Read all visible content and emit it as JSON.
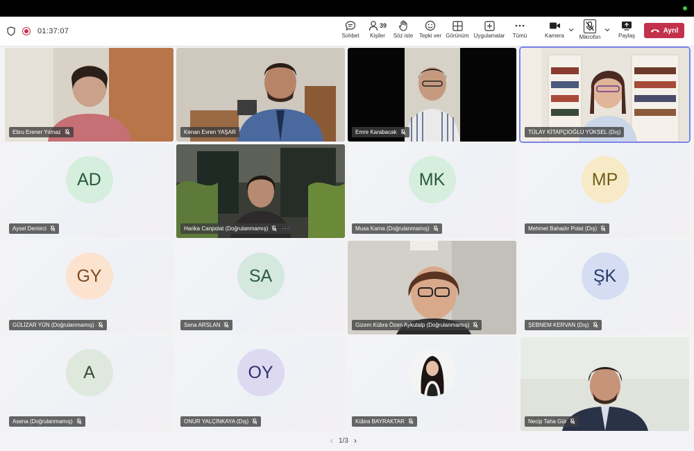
{
  "status": {
    "timer": "01:37:07"
  },
  "toolbar": {
    "chat": "Sohbet",
    "people": "Kişiler",
    "people_count": "39",
    "raise_hand": "Söz iste",
    "react": "Tepki ver",
    "view": "Görünüm",
    "apps": "Uygulamalar",
    "more": "Tümü",
    "camera": "Kamera",
    "mic": "Mikrofon",
    "share": "Paylaş",
    "leave": "Ayrıl"
  },
  "participants": [
    {
      "name": "Ebru Erener Yılmaz",
      "type": "video"
    },
    {
      "name": "Kenan Evren YAŞAR",
      "type": "video"
    },
    {
      "name": "Emre Karabacak",
      "type": "video"
    },
    {
      "name": "TÜLAY KİTAPÇIOĞLU YÜKSEL (Dış)",
      "type": "video",
      "active": true
    },
    {
      "name": "Aysel Demirci",
      "type": "initials",
      "initials": "AD",
      "avatar_bg": "#d6eedd",
      "avatar_fg": "#275b3a"
    },
    {
      "name": "Harika Canpolat (Doğrulanmamış)",
      "type": "video"
    },
    {
      "name": "Musa Kama (Doğrulanmamış)",
      "type": "initials",
      "initials": "MK",
      "avatar_bg": "#d6eedd",
      "avatar_fg": "#275b3a"
    },
    {
      "name": "Mehmet Bahadır Polat (Dış)",
      "type": "initials",
      "initials": "MP",
      "avatar_bg": "#f7ebc7",
      "avatar_fg": "#735c1a"
    },
    {
      "name": "GÜLİZAR YÜN (Doğrulanmamış)",
      "type": "initials",
      "initials": "GY",
      "avatar_bg": "#fbe3cf",
      "avatar_fg": "#7a4a21"
    },
    {
      "name": "Sena ARSLAN",
      "type": "initials",
      "initials": "SA",
      "avatar_bg": "#d5e8df",
      "avatar_fg": "#2a5a45"
    },
    {
      "name": "Gizem Kübra Özen Aykutalp (Doğrulanmamış)",
      "type": "video"
    },
    {
      "name": "ŞEBNEM KERVAN (Dış)",
      "type": "initials",
      "initials": "ŞK",
      "avatar_bg": "#d4ddf2",
      "avatar_fg": "#27376b"
    },
    {
      "name": "Asena (Doğrulanmamış)",
      "type": "initials",
      "initials": "A",
      "avatar_bg": "#dfe8dc",
      "avatar_fg": "#3a4a34"
    },
    {
      "name": "ONUR YALÇINKAYA (Dış)",
      "type": "initials",
      "initials": "OY",
      "avatar_bg": "#dcd9f1",
      "avatar_fg": "#33306b"
    },
    {
      "name": "Kübra BAYRAKTAR",
      "type": "photo"
    },
    {
      "name": "Necip Taha Gür",
      "type": "video"
    }
  ],
  "pager": {
    "label": "1/3"
  },
  "colors": {
    "leave": "#c4314b",
    "active_border": "#7b83eb",
    "name_tag_bg": "#3c3c3c"
  }
}
